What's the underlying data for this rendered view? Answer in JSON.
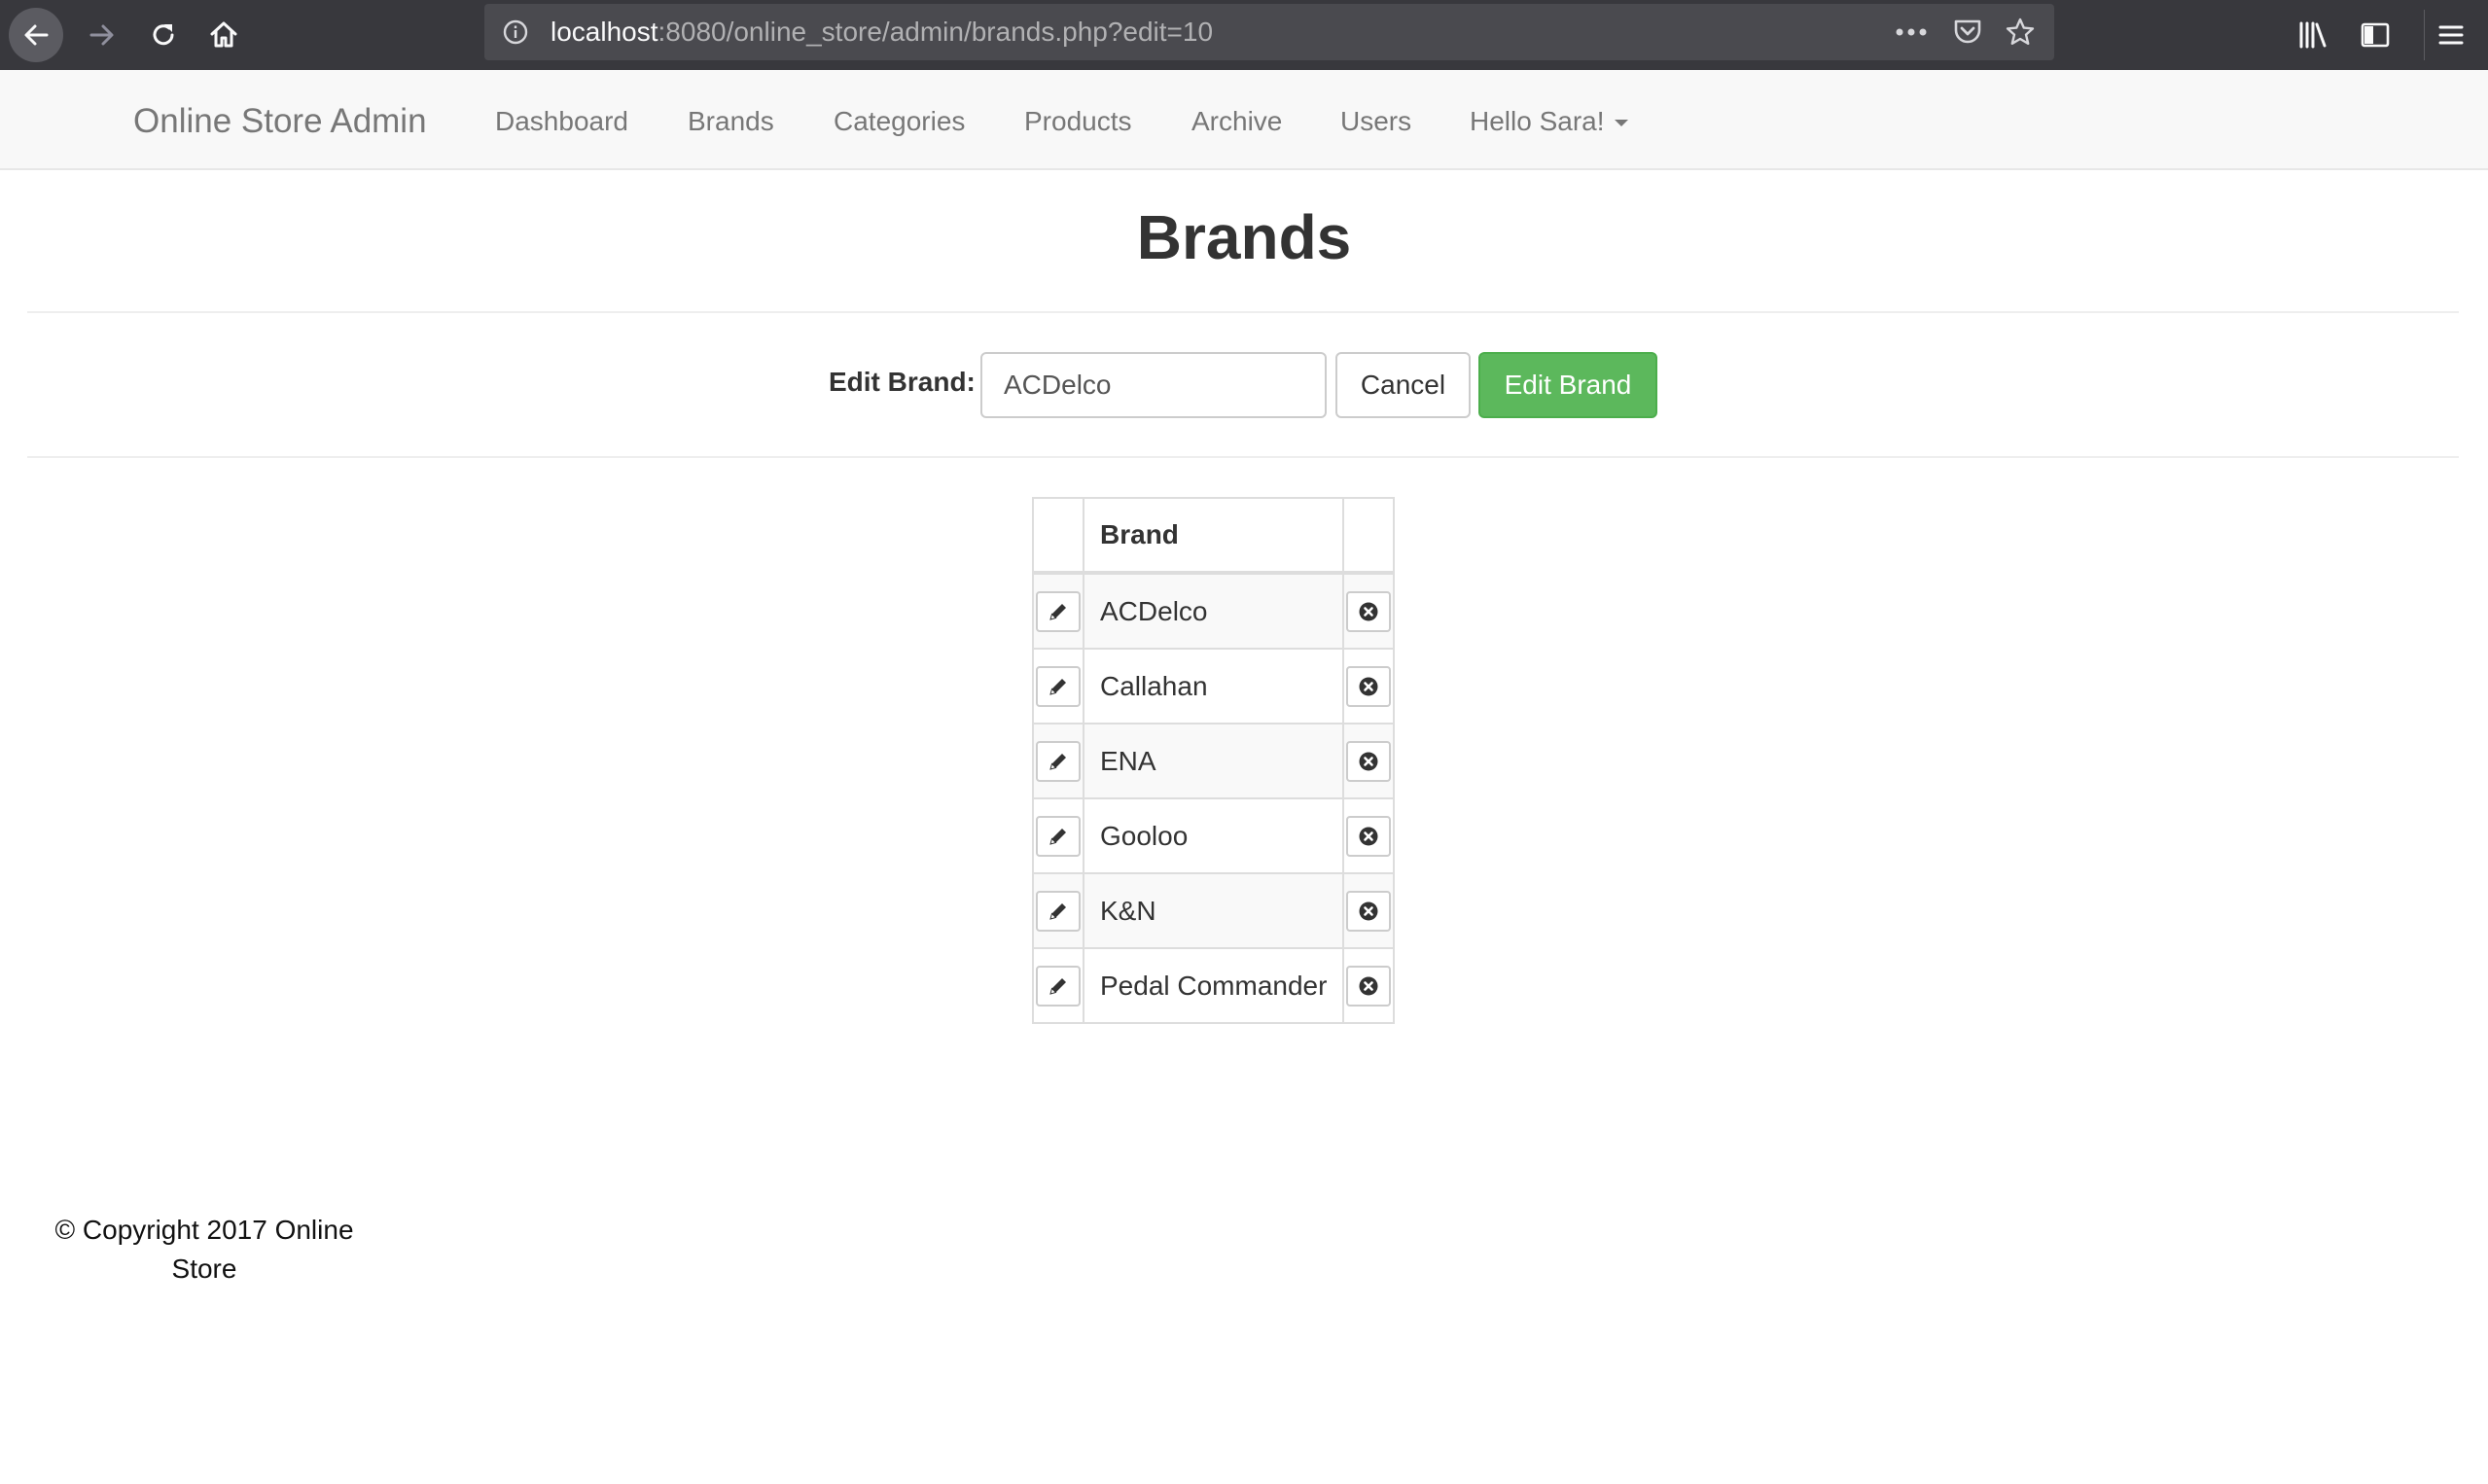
{
  "browser": {
    "url_host": "localhost",
    "url_rest": ":8080/online_store/admin/brands.php?edit=10"
  },
  "navbar": {
    "brand": "Online Store Admin",
    "links": [
      {
        "label": "Dashboard"
      },
      {
        "label": "Brands"
      },
      {
        "label": "Categories"
      },
      {
        "label": "Products"
      },
      {
        "label": "Archive"
      },
      {
        "label": "Users"
      }
    ],
    "user_menu": "Hello Sara!"
  },
  "page": {
    "title": "Brands"
  },
  "form": {
    "label": "Edit Brand:",
    "input_value": "ACDelco",
    "cancel_label": "Cancel",
    "submit_label": "Edit Brand"
  },
  "table": {
    "header": {
      "brand": "Brand"
    },
    "rows": [
      {
        "name": "ACDelco"
      },
      {
        "name": "Callahan"
      },
      {
        "name": "ENA"
      },
      {
        "name": "Gooloo"
      },
      {
        "name": "K&N"
      },
      {
        "name": "Pedal Commander"
      }
    ],
    "edit_icon": "pencil-icon",
    "delete_icon": "remove-circle-icon"
  },
  "footer": {
    "line1": "© Copyright 2017 Online",
    "line2": "Store"
  },
  "colors": {
    "chrome_bg": "#38383d",
    "urlbar_bg": "#4a4a4f",
    "navbar_bg": "#f8f8f8",
    "success": "#5cb85c"
  }
}
